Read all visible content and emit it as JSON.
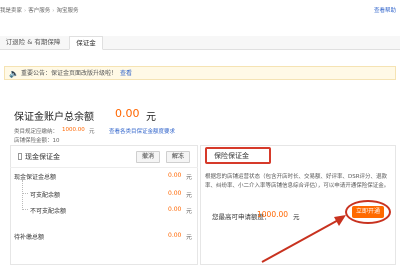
{
  "breadcrumb": {
    "items": [
      "我是卖家",
      "客户服务",
      "淘宝服务"
    ],
    "right_link": "查看帮助"
  },
  "tabs": [
    {
      "label": "订退险 & 有期保障"
    },
    {
      "label": "保证金"
    }
  ],
  "notice": {
    "text": "重要公告：保证金页面改版升级啦！",
    "link": "查看"
  },
  "summary": {
    "label": "保证金账户总余额",
    "amount": "0.00",
    "unit": "元",
    "category_label": "类目规定应缴纳：",
    "category_amount": "1000.00",
    "category_unit": "元",
    "category_link": "查看各类目保证金额度要求",
    "insure_label": "店铺保险金额：",
    "insure_value": "10"
  },
  "cash_panel": {
    "title": "现金保证金",
    "withdraw_button": "撤消",
    "unfreeze_button": "解冻",
    "rows": [
      {
        "label": "现金保证金总额",
        "value": "0.00",
        "unit": "元"
      },
      {
        "label": "可支配余额",
        "value": "0.00",
        "unit": "元"
      },
      {
        "label": "不可支配余额",
        "value": "0.00",
        "unit": "元"
      },
      {
        "label": "待补缴总额",
        "value": "0.00",
        "unit": "元"
      }
    ]
  },
  "insurance_panel": {
    "title": "保险保证金",
    "description": "根据您的店铺运营状态（包含开店时长、交易额、好评率、DSR评分、退款率、纠纷率、小二介入率等店铺信息综合评估），可以申请开通保险保证金。",
    "amount_label": "您最高可申请额度：",
    "amount": "1000.00",
    "amount_unit": "元",
    "open_button": "立即开通"
  },
  "colors": {
    "accent_orange": "#ff6600",
    "highlight_red": "#d63a2a",
    "link_blue": "#3366cc"
  }
}
